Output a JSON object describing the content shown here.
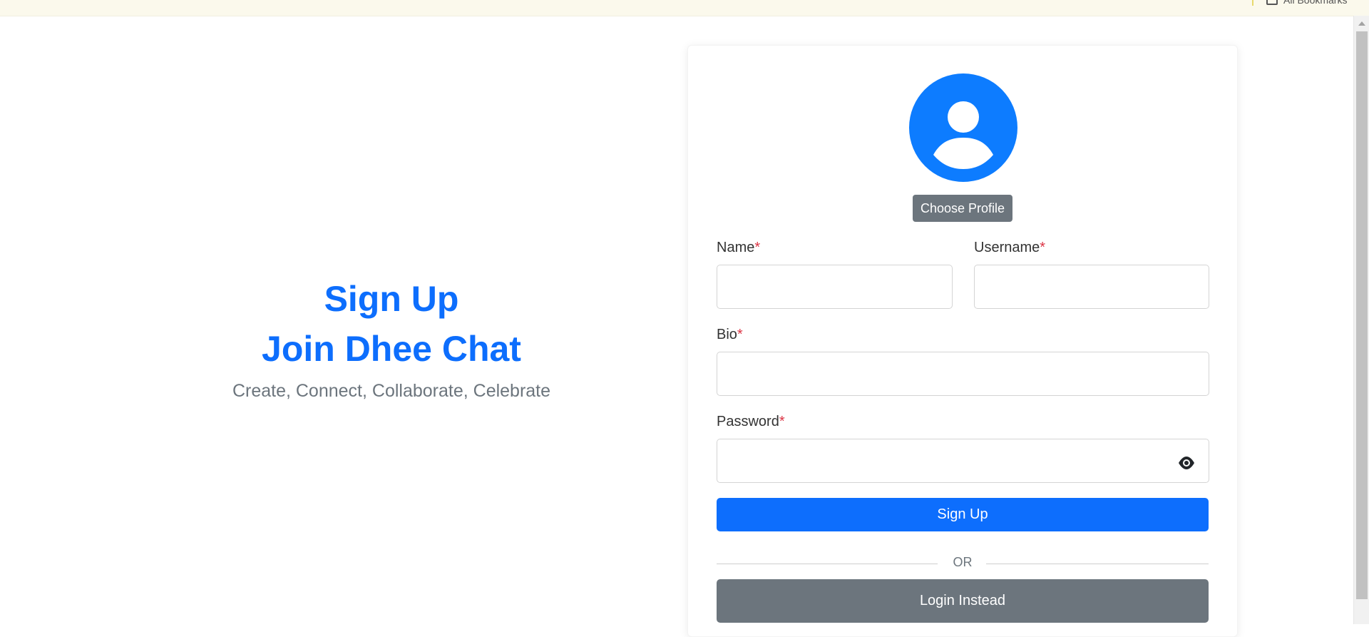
{
  "browser": {
    "bookmarks_label": "All Bookmarks"
  },
  "hero": {
    "title_line1": "Sign Up",
    "title_line2": "Join Dhee Chat",
    "tagline": "Create, Connect, Collaborate, Celebrate"
  },
  "form": {
    "choose_profile_label": "Choose Profile",
    "name": {
      "label": "Name",
      "required_mark": "*",
      "value": ""
    },
    "username": {
      "label": "Username",
      "required_mark": "*",
      "value": ""
    },
    "bio": {
      "label": "Bio",
      "required_mark": "*",
      "value": ""
    },
    "password": {
      "label": "Password",
      "required_mark": "*",
      "value": ""
    },
    "signup_label": "Sign Up",
    "or_label": "OR",
    "login_label": "Login Instead"
  },
  "colors": {
    "primary": "#0d6efd",
    "avatar": "#0d7cff",
    "secondary": "#6c757d",
    "required": "#dc3545"
  },
  "icons": {
    "avatar": "user-silhouette-icon",
    "password_toggle": "eye-icon",
    "bookmarks": "folder-icon"
  }
}
